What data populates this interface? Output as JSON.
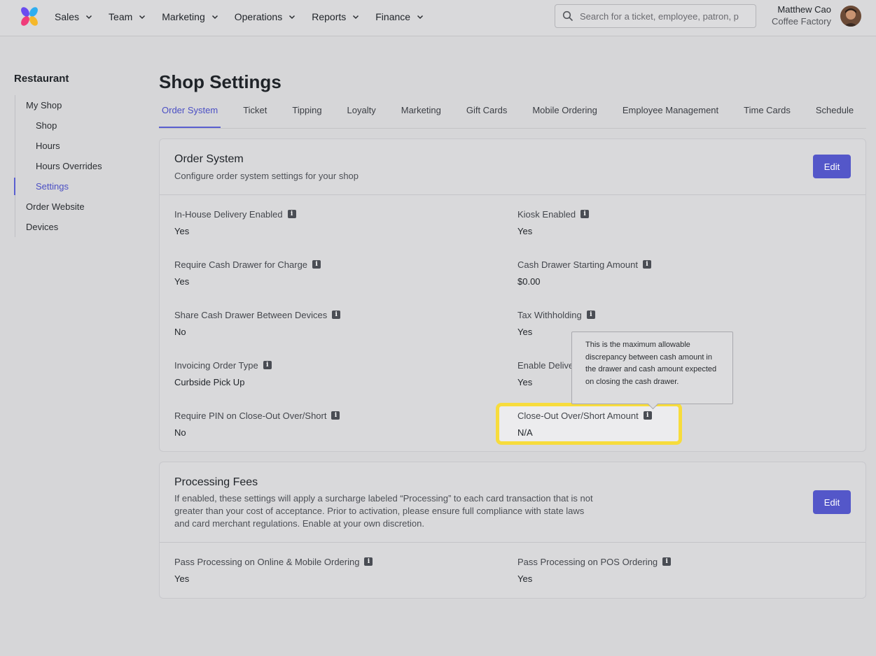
{
  "nav": {
    "items": [
      "Sales",
      "Team",
      "Marketing",
      "Operations",
      "Reports",
      "Finance"
    ],
    "search_placeholder": "Search for a ticket, employee, patron, p",
    "user_name": "Matthew Cao",
    "user_company": "Coffee Factory"
  },
  "sidebar": {
    "title": "Restaurant",
    "items": {
      "my_shop": "My Shop",
      "shop": "Shop",
      "hours": "Hours",
      "hours_overrides": "Hours Overrides",
      "settings": "Settings",
      "order_website": "Order Website",
      "devices": "Devices"
    }
  },
  "page": {
    "title": "Shop Settings",
    "tabs": [
      "Order System",
      "Ticket",
      "Tipping",
      "Loyalty",
      "Marketing",
      "Gift Cards",
      "Mobile Ordering",
      "Employee Management",
      "Time Cards",
      "Schedule"
    ]
  },
  "order_system": {
    "title": "Order System",
    "subtitle": "Configure order system settings for your shop",
    "edit_label": "Edit",
    "fields": {
      "in_house_delivery": {
        "label": "In-House Delivery Enabled",
        "value": "Yes"
      },
      "kiosk": {
        "label": "Kiosk Enabled",
        "value": "Yes"
      },
      "require_cash_drawer": {
        "label": "Require Cash Drawer for Charge",
        "value": "Yes"
      },
      "cash_drawer_start": {
        "label": "Cash Drawer Starting Amount",
        "value": "$0.00"
      },
      "share_cash_drawer": {
        "label": "Share Cash Drawer Between Devices",
        "value": "No"
      },
      "tax_withholding": {
        "label": "Tax Withholding",
        "value": "Yes"
      },
      "invoicing_order_type": {
        "label": "Invoicing Order Type",
        "value": "Curbside Pick Up"
      },
      "enable_delivery": {
        "label": "Enable Delive",
        "value": "Yes"
      },
      "require_pin": {
        "label": "Require PIN on Close-Out Over/Short",
        "value": "No"
      },
      "close_out_amount": {
        "label": "Close-Out Over/Short Amount",
        "value": "N/A"
      }
    },
    "tooltip": "This is the maximum allowable discrepancy between cash amount in the drawer and cash amount expected on closing the cash drawer."
  },
  "processing_fees": {
    "title": "Processing Fees",
    "subtitle": "If enabled, these settings will apply a surcharge labeled “Processing” to each card transaction that is not greater than your cost of acceptance. Prior to activation, please ensure full compliance with state laws and card merchant regulations. Enable at your own discretion.",
    "edit_label": "Edit",
    "fields": {
      "online_mobile": {
        "label": "Pass Processing on Online & Mobile Ordering",
        "value": "Yes"
      },
      "pos": {
        "label": "Pass Processing on POS Ordering",
        "value": "Yes"
      }
    }
  },
  "colors": {
    "accent": "#5457c9",
    "highlight": "#f7dc3c"
  }
}
